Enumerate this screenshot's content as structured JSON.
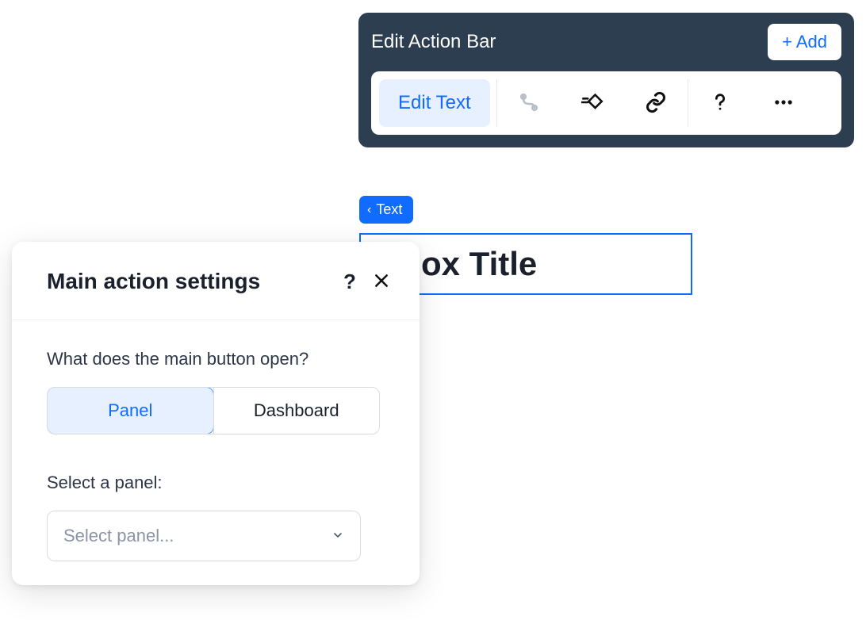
{
  "actionBar": {
    "title": "Edit Action Bar",
    "addLabel": "+ Add",
    "editTextLabel": "Edit Text"
  },
  "breadcrumb": {
    "label": "Text"
  },
  "titleField": {
    "value": "ox Title"
  },
  "settings": {
    "title": "Main action settings",
    "question": "What does the main button open?",
    "options": {
      "panel": "Panel",
      "dashboard": "Dashboard"
    },
    "selectLabel": "Select a panel:",
    "selectPlaceholder": "Select panel..."
  }
}
